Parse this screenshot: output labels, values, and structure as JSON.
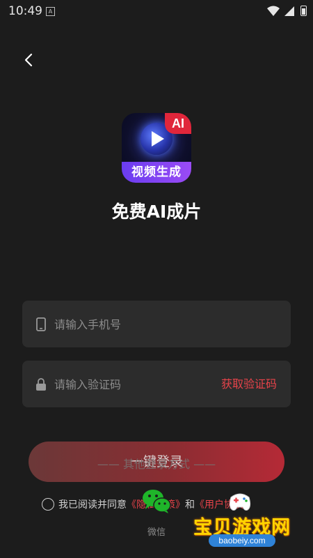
{
  "status_bar": {
    "time": "10:49",
    "notification": "A"
  },
  "logo": {
    "badge": "AI",
    "caption": "视频生成"
  },
  "app_title": "免费AI成片",
  "phone_field": {
    "placeholder": "请输入手机号",
    "value": ""
  },
  "code_field": {
    "placeholder": "请输入验证码",
    "value": "",
    "get_code_label": "获取验证码"
  },
  "login_button": {
    "label": "一键登录"
  },
  "other_login": "—— 其他登录方式 ——",
  "agreement": {
    "prefix": "我已阅读并同意",
    "privacy_policy": "《隐私政策》",
    "conjunction": "和",
    "user_agreement": "《用户协议》"
  },
  "wechat": {
    "label": "微信"
  },
  "watermark": {
    "text": "宝贝游戏网",
    "url": "baobeiy.com"
  },
  "colors": {
    "background": "#1c1c1c",
    "field": "#2c2c2c",
    "accent_red": "#e8434a"
  },
  "icons": [
    "back-icon",
    "phone-icon",
    "lock-icon",
    "wechat-icon",
    "wifi-icon",
    "signal-icon",
    "battery-icon"
  ]
}
